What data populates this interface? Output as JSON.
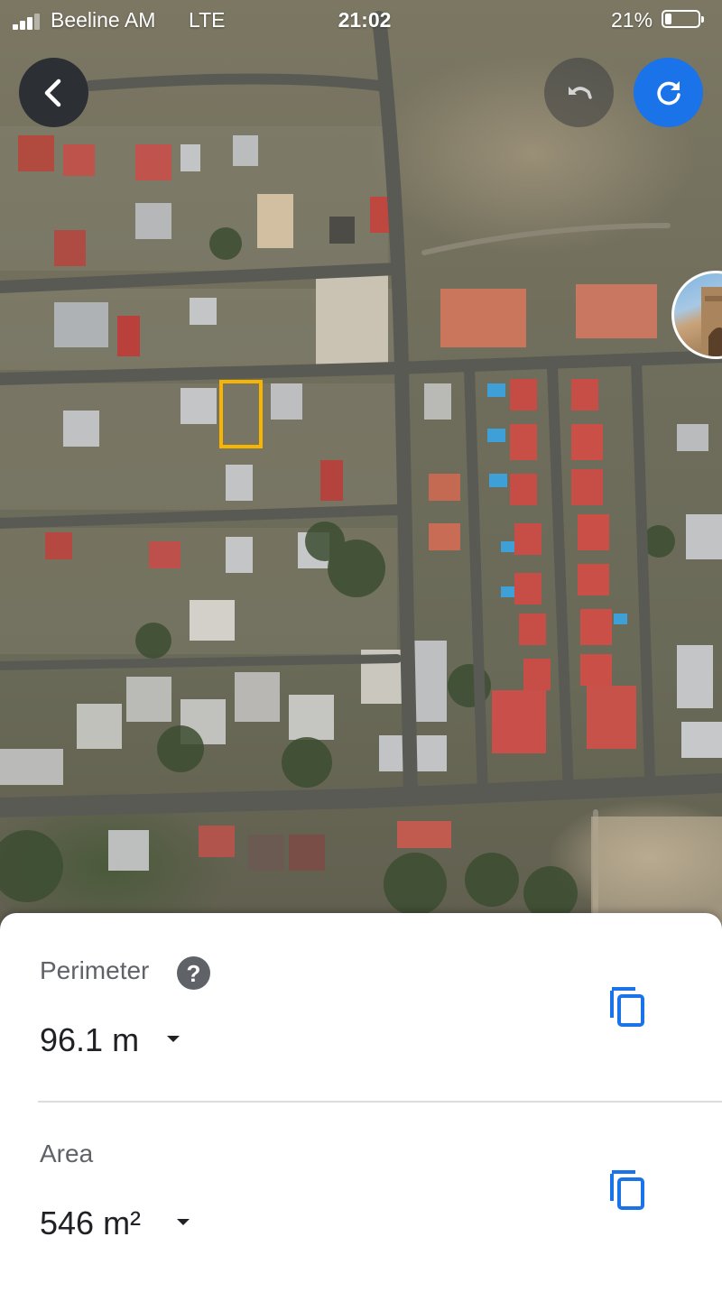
{
  "status_bar": {
    "carrier": "Beeline AM",
    "network": "LTE",
    "time": "21:02",
    "battery_percent": "21%",
    "battery_level": 0.21,
    "signal_bars": 3
  },
  "map": {
    "type": "satellite",
    "selection_outline_color": "#f7b500"
  },
  "buttons": {
    "back_icon": "chevron-left-icon",
    "undo_icon": "undo-icon",
    "redo_icon": "refresh-icon",
    "redo_color": "#1a73e8"
  },
  "measurements": {
    "perimeter": {
      "label": "Perimeter",
      "help": "?",
      "value": "96.1 m",
      "copy_icon": "copy-icon"
    },
    "area": {
      "label": "Area",
      "value": "546 m²",
      "copy_icon": "copy-icon"
    },
    "icon_color": "#1a73e8"
  }
}
